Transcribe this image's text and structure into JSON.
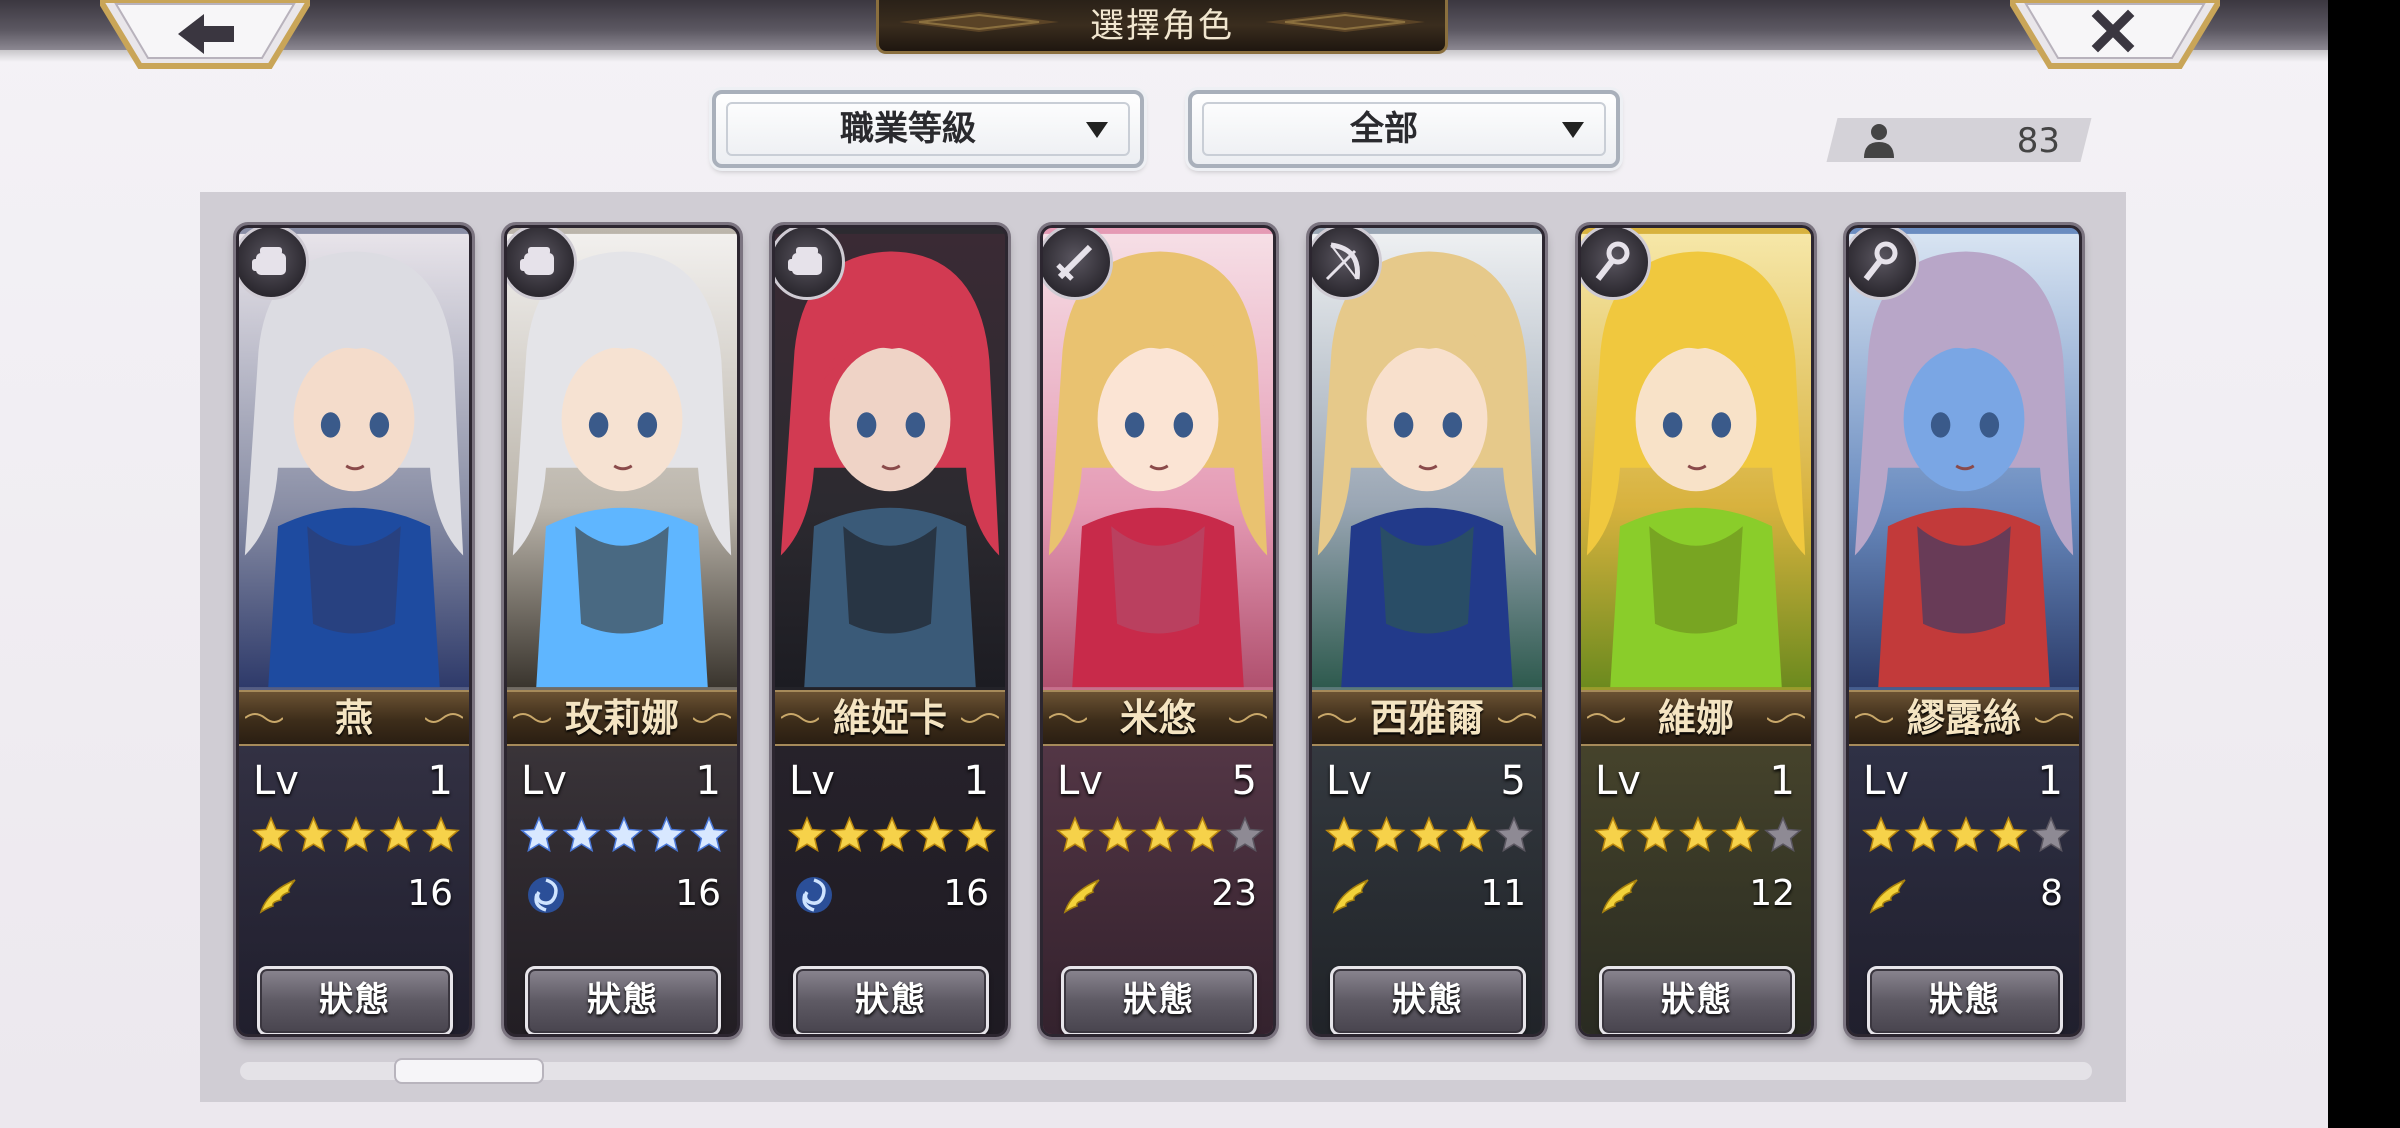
{
  "header": {
    "title": "選擇角色",
    "back_icon": "arrow-left-icon",
    "close_icon": "close-x-icon"
  },
  "filters": {
    "job_level": "職業等級",
    "category": "全部",
    "caret_icon": "triangle-down-icon"
  },
  "character_count": {
    "icon": "person-icon",
    "value": "83"
  },
  "cards": [
    {
      "name": "燕",
      "lv_label": "Lv",
      "level": "1",
      "stars": 5,
      "max_stars": 5,
      "star_color": "gold",
      "element": "wind-wing-icon",
      "element_value": "16",
      "status_label": "狀態",
      "class_icon": "fist-icon"
    },
    {
      "name": "玫莉娜",
      "lv_label": "Lv",
      "level": "1",
      "stars": 5,
      "max_stars": 5,
      "star_color": "blue",
      "element": "swirl-icon",
      "element_value": "16",
      "status_label": "狀態",
      "class_icon": "fist-icon"
    },
    {
      "name": "維婭卡",
      "lv_label": "Lv",
      "level": "1",
      "stars": 5,
      "max_stars": 5,
      "star_color": "gold",
      "element": "swirl-icon",
      "element_value": "16",
      "status_label": "狀態",
      "class_icon": "fist-icon"
    },
    {
      "name": "米悠",
      "lv_label": "Lv",
      "level": "5",
      "stars": 4,
      "max_stars": 5,
      "star_color": "gold",
      "element": "wind-wing-icon",
      "element_value": "23",
      "status_label": "狀態",
      "class_icon": "sword-icon"
    },
    {
      "name": "西雅爾",
      "lv_label": "Lv",
      "level": "5",
      "stars": 4,
      "max_stars": 5,
      "star_color": "gold",
      "element": "wind-wing-icon",
      "element_value": "11",
      "status_label": "狀態",
      "class_icon": "bow-icon"
    },
    {
      "name": "維娜",
      "lv_label": "Lv",
      "level": "1",
      "stars": 4,
      "max_stars": 5,
      "star_color": "gold",
      "element": "wind-wing-icon",
      "element_value": "12",
      "status_label": "狀態",
      "class_icon": "staff-icon"
    },
    {
      "name": "繆露絲",
      "lv_label": "Lv",
      "level": "1",
      "stars": 4,
      "max_stars": 5,
      "star_color": "gold",
      "element": "wind-wing-icon",
      "element_value": "8",
      "status_label": "狀態",
      "class_icon": "staff-icon"
    }
  ]
}
